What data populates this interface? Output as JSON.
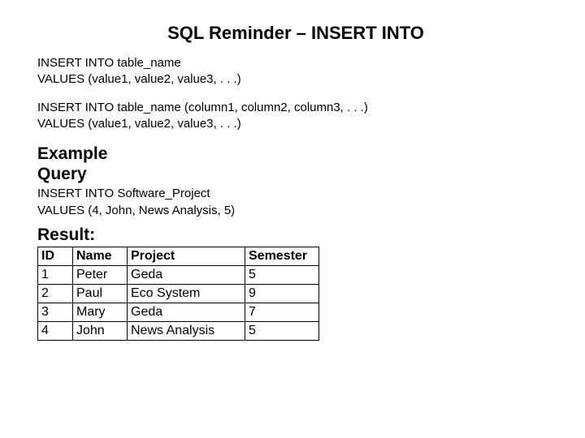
{
  "title": "SQL Reminder – INSERT INTO",
  "syntax1": {
    "line1": "INSERT INTO table_name",
    "line2": "VALUES (value1, value2, value3, . . .)"
  },
  "syntax2": {
    "line1": "INSERT INTO table_name (column1, column2, column3, . . .)",
    "line2": "VALUES (value1, value2, value3, . . .)"
  },
  "example_heading_line1": "Example",
  "example_heading_line2": "Query",
  "query": {
    "line1": "INSERT INTO Software_Project",
    "line2": "VALUES (4, John, News Analysis, 5)"
  },
  "result_heading": "Result:",
  "table": {
    "headers": {
      "id": "ID",
      "name": "Name",
      "project": "Project",
      "semester": "Semester"
    },
    "rows": [
      {
        "id": "1",
        "name": "Peter",
        "project": "Geda",
        "semester": "5"
      },
      {
        "id": "2",
        "name": "Paul",
        "project": "Eco System",
        "semester": "9"
      },
      {
        "id": "3",
        "name": "Mary",
        "project": "Geda",
        "semester": "7"
      },
      {
        "id": "4",
        "name": "John",
        "project": "News Analysis",
        "semester": "5"
      }
    ]
  }
}
